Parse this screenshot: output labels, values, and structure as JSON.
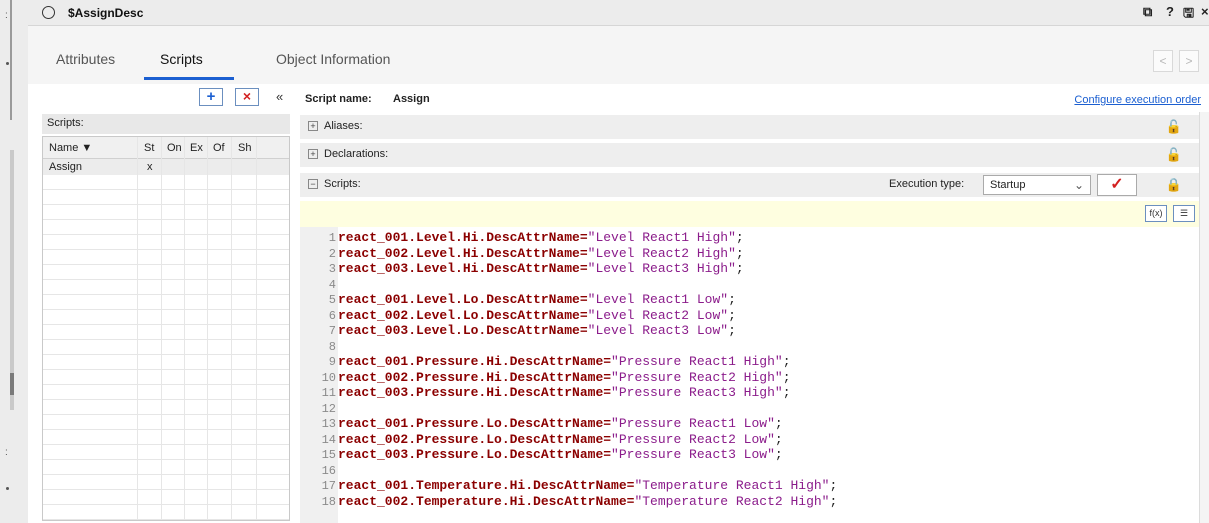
{
  "window": {
    "title": "$AssignDesc",
    "buttons": {
      "restore": "⧉",
      "help": "?",
      "save": "🖫",
      "close": "×"
    }
  },
  "tabs": [
    "Attributes",
    "Scripts",
    "Object Information"
  ],
  "nav": {
    "prev": "<",
    "next": ">"
  },
  "left": {
    "add_label": "+",
    "delete_label": "×",
    "collapse_label": "«",
    "scripts_label": "Scripts:",
    "columns": [
      "Name ▼",
      "St",
      "On",
      "Ex",
      "Of",
      "Sh"
    ],
    "rows": [
      {
        "name": "Assign",
        "st": "x",
        "on": "",
        "ex": "",
        "of": "",
        "sh": ""
      }
    ]
  },
  "script": {
    "name_label": "Script name:",
    "name_value": "Assign",
    "configure_link": "Configure execution order",
    "aliases_label": "Aliases:",
    "declarations_label": "Declarations:",
    "scripts_label": "Scripts:",
    "execution_type_label": "Execution type:",
    "execution_type_value": "Startup",
    "apply_label": "✓"
  },
  "code": [
    {
      "n": "1",
      "ident": "react_001.Level.Hi.DescAttrName=",
      "str": "\"Level React1 High\"",
      "tail": ";"
    },
    {
      "n": "2",
      "ident": "react_002.Level.Hi.DescAttrName=",
      "str": "\"Level React2 High\"",
      "tail": ";"
    },
    {
      "n": "3",
      "ident": "react_003.Level.Hi.DescAttrName=",
      "str": "\"Level React3 High\"",
      "tail": ";"
    },
    {
      "n": "4",
      "ident": "",
      "str": "",
      "tail": ""
    },
    {
      "n": "5",
      "ident": "react_001.Level.Lo.DescAttrName=",
      "str": "\"Level React1 Low\"",
      "tail": ";"
    },
    {
      "n": "6",
      "ident": "react_002.Level.Lo.DescAttrName=",
      "str": "\"Level React2 Low\"",
      "tail": ";"
    },
    {
      "n": "7",
      "ident": "react_003.Level.Lo.DescAttrName=",
      "str": "\"Level React3 Low\"",
      "tail": ";"
    },
    {
      "n": "8",
      "ident": "",
      "str": "",
      "tail": ""
    },
    {
      "n": "9",
      "ident": "react_001.Pressure.Hi.DescAttrName=",
      "str": "\"Pressure React1 High\"",
      "tail": ";"
    },
    {
      "n": "10",
      "ident": "react_002.Pressure.Hi.DescAttrName=",
      "str": "\"Pressure React2 High\"",
      "tail": ";"
    },
    {
      "n": "11",
      "ident": "react_003.Pressure.Hi.DescAttrName=",
      "str": "\"Pressure React3 High\"",
      "tail": ";"
    },
    {
      "n": "12",
      "ident": "",
      "str": "",
      "tail": ""
    },
    {
      "n": "13",
      "ident": "react_001.Pressure.Lo.DescAttrName=",
      "str": "\"Pressure React1 Low\"",
      "tail": ";"
    },
    {
      "n": "14",
      "ident": "react_002.Pressure.Lo.DescAttrName=",
      "str": "\"Pressure React2 Low\"",
      "tail": ";"
    },
    {
      "n": "15",
      "ident": "react_003.Pressure.Lo.DescAttrName=",
      "str": "\"Pressure React3 Low\"",
      "tail": ";"
    },
    {
      "n": "16",
      "ident": "",
      "str": "",
      "tail": ""
    },
    {
      "n": "17",
      "ident": "react_001.Temperature.Hi.DescAttrName=",
      "str": "\"Temperature React1 High\"",
      "tail": ";"
    },
    {
      "n": "18",
      "ident": "react_002.Temperature.Hi.DescAttrName=",
      "str": "\"Temperature React2 High\"",
      "tail": ";"
    }
  ],
  "colors": {
    "accent": "#1b5fd1",
    "identifier": "#8b0000",
    "string": "#8b1c8b",
    "lock": "#4a7d10",
    "delete": "#d32020"
  }
}
